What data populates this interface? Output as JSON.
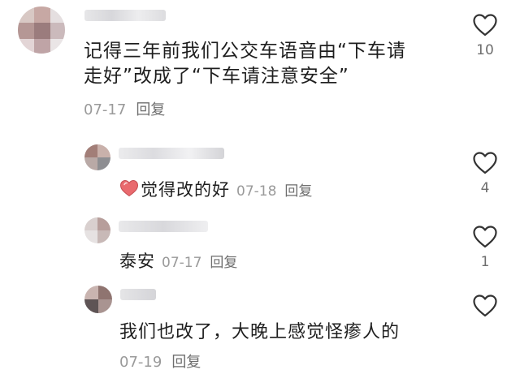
{
  "comments": [
    {
      "text_line1": "记得三年前我们公交车语音由“下车请",
      "text_line2": "走好”改成了“下车请注意安全”",
      "date": "07-17",
      "reply_label": "回复",
      "likes": "10"
    },
    {
      "text": "觉得改的好",
      "date": "07-18",
      "reply_label": "回复",
      "likes": "4",
      "emoji_icon": "heart-emoji-icon"
    },
    {
      "text": "泰安",
      "date": "07-17",
      "reply_label": "回复",
      "likes": "1"
    },
    {
      "text": "我们也改了，大晚上感觉怪瘆人的",
      "date": "07-19",
      "reply_label": "回复"
    }
  ],
  "colors": {
    "text": "#1e1e1e",
    "meta": "#9a9a9a",
    "reply": "#6e6e6e",
    "heart_outline": "#333333"
  },
  "icons": {
    "like": "heart-outline-icon"
  }
}
